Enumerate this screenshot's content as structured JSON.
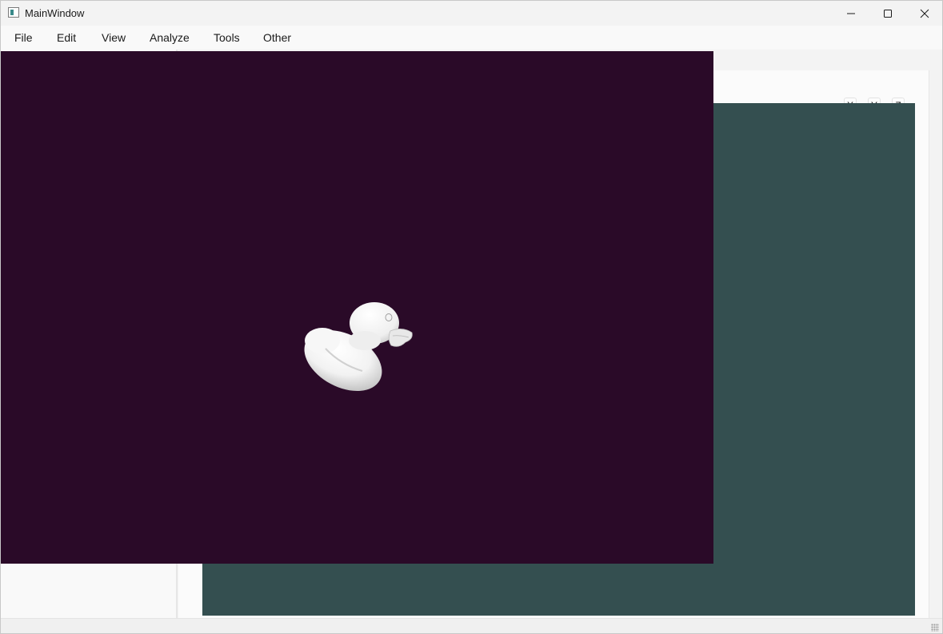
{
  "window": {
    "title": "MainWindow"
  },
  "menu": {
    "items": [
      "File",
      "Edit",
      "View",
      "Analyze",
      "Tools",
      "Other"
    ]
  },
  "toolbar": {
    "axis_buttons": [
      "X",
      "Y",
      "Z"
    ]
  },
  "viewports": {
    "teal_background": "#344f50",
    "purple_background": "#2a0a28",
    "model_icon": "rubber-duck-model"
  },
  "colors": {
    "titlebar_bg": "#f3f3f3",
    "menubar_bg": "#f9f9f9"
  }
}
